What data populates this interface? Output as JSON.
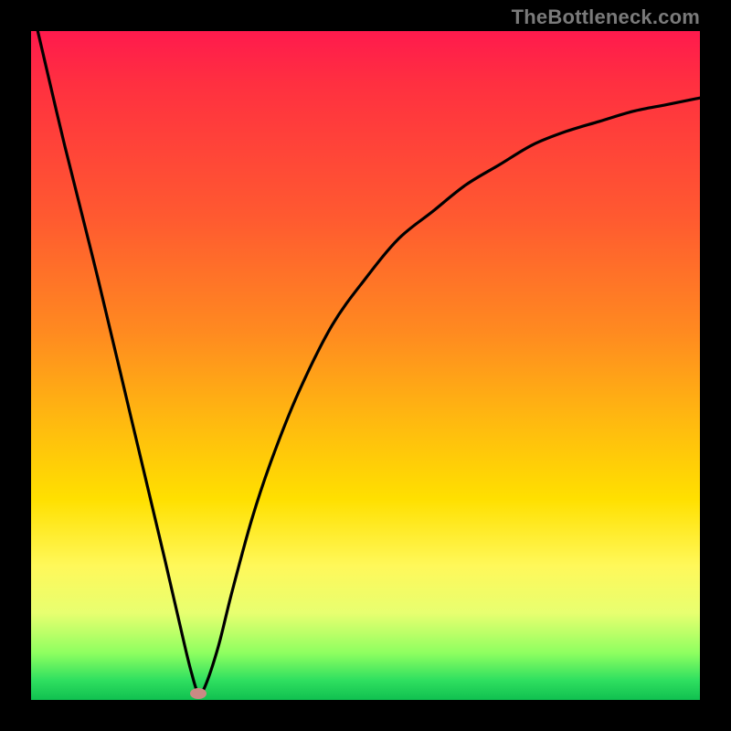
{
  "watermark_text": "TheBottleneck.com",
  "chart_data": {
    "type": "line",
    "title": "",
    "xlabel": "",
    "ylabel": "",
    "xlim": [
      0,
      100
    ],
    "ylim": [
      0,
      100
    ],
    "grid": false,
    "legend": false,
    "series": [
      {
        "name": "curve",
        "x": [
          1,
          5,
          10,
          15,
          20,
          23,
          24,
          25,
          26,
          28,
          30,
          33,
          36,
          40,
          45,
          50,
          55,
          60,
          65,
          70,
          75,
          80,
          85,
          90,
          95,
          100
        ],
        "y": [
          100,
          83,
          63,
          42,
          21,
          8,
          4,
          1,
          2,
          8,
          16,
          27,
          36,
          46,
          56,
          63,
          69,
          73,
          77,
          80,
          83,
          85,
          86.5,
          88,
          89,
          90
        ]
      }
    ],
    "markers": [
      {
        "name": "minimum-point",
        "x": 25,
        "y": 1
      }
    ],
    "background": {
      "type": "vertical-gradient",
      "stops": [
        {
          "pos": 0,
          "color": "#ff1a4d"
        },
        {
          "pos": 28,
          "color": "#ff5a30"
        },
        {
          "pos": 58,
          "color": "#ffb810"
        },
        {
          "pos": 80,
          "color": "#fff85a"
        },
        {
          "pos": 100,
          "color": "#10c050"
        }
      ],
      "note": "y=0 maps to green (bottom), y=100 maps to red (top)"
    }
  }
}
